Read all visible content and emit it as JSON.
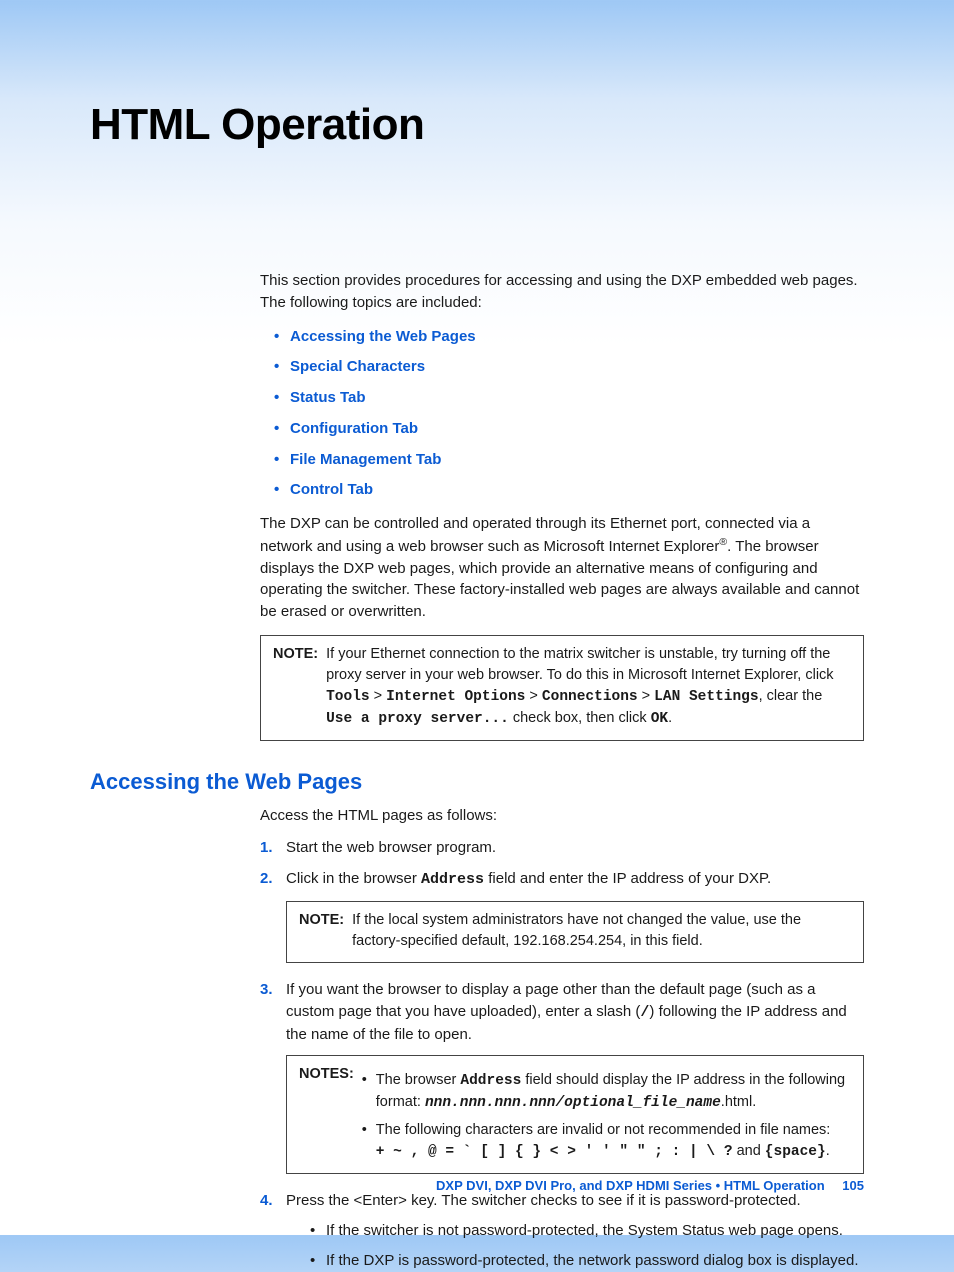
{
  "title": "HTML Operation",
  "intro": "This section provides procedures for accessing and using the DXP embedded web pages. The following topics are included:",
  "toc": [
    "Accessing the Web Pages",
    "Special Characters",
    "Status Tab",
    "Configuration Tab",
    "File Management Tab",
    "Control Tab"
  ],
  "body_para_pre": "The DXP can be controlled and operated through its Ethernet port, connected via a network and using a web browser such as Microsoft Internet Explorer",
  "body_para_post": ". The browser displays the DXP web pages, which provide an alternative means of configuring and operating the switcher. These factory-installed web pages are always available and cannot be erased or overwritten.",
  "note1": {
    "label": "NOTE:",
    "pre": "If your Ethernet connection to the matrix switcher is unstable, try turning off the proxy server in your web browser. To do this in Microsoft Internet Explorer, click ",
    "m1": "Tools",
    "sep": " > ",
    "m2": "Internet Options",
    "m3": "Connections",
    "m4": "LAN Settings",
    "mid1": ", clear the ",
    "m5": "Use a proxy server...",
    "mid2": " check box, then click ",
    "m6": "OK",
    "end": "."
  },
  "section_heading": "Accessing the Web Pages",
  "section_intro": "Access the HTML pages as follows:",
  "steps": {
    "s1": "Start the web browser program.",
    "s2_pre": "Click in the browser ",
    "s2_m": "Address",
    "s2_post": " field and enter the IP address of your DXP.",
    "s3_pre": "If you want the browser to display a page other than the default page (such as a custom page that you have uploaded), enter a slash (",
    "s3_m": "/",
    "s3_post": ") following the IP address and the name of the file to open.",
    "s4": "Press the <Enter> key. The switcher checks to see if it is password-protected.",
    "s4_sub1": "If the switcher is not password-protected, the System Status web page opens.",
    "s4_sub2": "If the DXP is password-protected, the network password dialog box is displayed."
  },
  "note2": {
    "label": "NOTE:",
    "text": "If the local system administrators have not changed the value, use the factory-specified default, 192.168.254.254, in this field."
  },
  "note3": {
    "label": "NOTES:",
    "b1_pre": "The browser ",
    "b1_m1": "Address",
    "b1_mid": " field should display the IP address in the following format: ",
    "b1_m2": "nnn.nnn.nnn.nnn/optional_file_name",
    "b1_post": ".html.",
    "b2_pre": "The following characters are invalid or not recommended in file names:",
    "b2_chars": "+ ~ , @ = ` [ ] { } < > ' ' \" \" ; : | \\ ?",
    "b2_mid": " and ",
    "b2_m": "{space}",
    "b2_end": "."
  },
  "footer": {
    "text": "DXP DVI, DXP DVI Pro, and DXP HDMI Series • HTML Operation",
    "page": "105"
  }
}
